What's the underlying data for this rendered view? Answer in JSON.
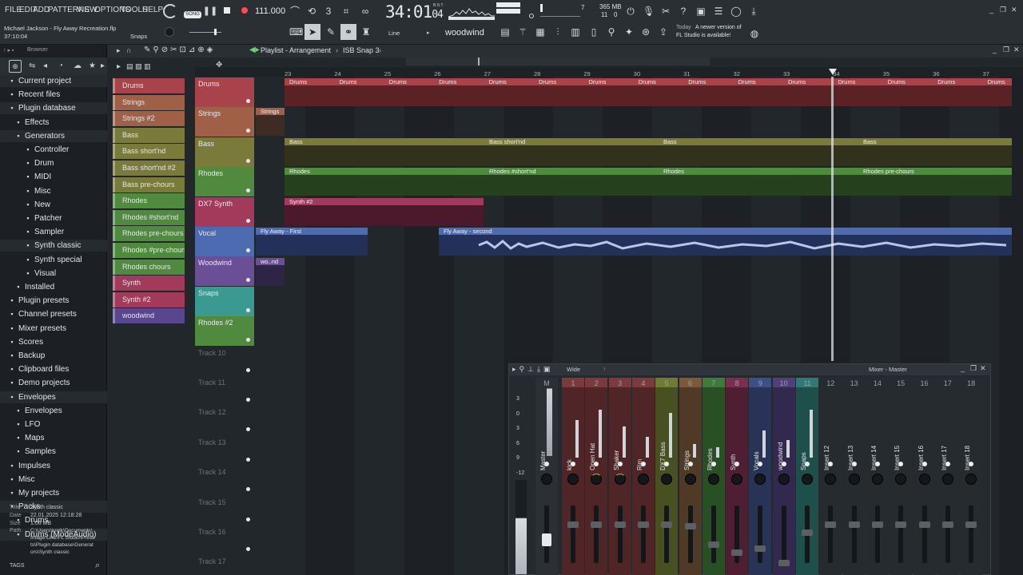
{
  "menu": [
    "FILE",
    "EDIT",
    "ADD",
    "PATTERNS",
    "VIEW",
    "OPTIONS",
    "TOOLS",
    "HELP"
  ],
  "transport": {
    "mode": "SONG",
    "tempo": "111.000",
    "time_main": "34:01",
    "time_sub": "04",
    "time_label": "B:S:T",
    "memory": "365 MB",
    "cpu": "11",
    "cpu_val": "0",
    "pattern_val": "7"
  },
  "project": {
    "title": "Michael Jackson - Fly Away Recreation.flp",
    "time": "37:10:04",
    "snap_label": "Snaps"
  },
  "toolbar": {
    "line_label": "Line",
    "instrument": "woodwind"
  },
  "notice": {
    "date": "Today",
    "message_line1": "A newer version of",
    "message_line2": "FL Studio is available!"
  },
  "browser": {
    "title": "Browser",
    "items": [
      {
        "label": "Current project",
        "icon": "project-icon"
      },
      {
        "label": "Recent files",
        "icon": "recent-icon"
      },
      {
        "label": "Plugin database",
        "icon": "plug-icon"
      },
      {
        "label": "Effects",
        "icon": "effects-icon"
      },
      {
        "label": "Generators",
        "icon": "generators-icon"
      },
      {
        "label": "Controller",
        "icon": "folder-icon"
      },
      {
        "label": "Drum",
        "icon": "folder-icon"
      },
      {
        "label": "MIDI",
        "icon": "folder-icon"
      },
      {
        "label": "Misc",
        "icon": "folder-icon"
      },
      {
        "label": "New",
        "icon": "folder-icon"
      },
      {
        "label": "Patcher",
        "icon": "folder-icon"
      },
      {
        "label": "Sampler",
        "icon": "folder-icon"
      },
      {
        "label": "Synth classic",
        "icon": "folder-icon"
      },
      {
        "label": "Synth special",
        "icon": "folder-icon"
      },
      {
        "label": "Visual",
        "icon": "folder-icon"
      },
      {
        "label": "Installed",
        "icon": "plug-icon"
      },
      {
        "label": "Plugin presets",
        "icon": "plug-icon"
      },
      {
        "label": "Channel presets",
        "icon": "channel-icon"
      },
      {
        "label": "Mixer presets",
        "icon": "mixer-icon"
      },
      {
        "label": "Scores",
        "icon": "note-icon"
      },
      {
        "label": "Backup",
        "icon": "folder-icon"
      },
      {
        "label": "Clipboard files",
        "icon": "folder-icon"
      },
      {
        "label": "Demo projects",
        "icon": "folder-icon"
      },
      {
        "label": "Envelopes",
        "icon": "folder-icon"
      },
      {
        "label": "Envelopes",
        "icon": "folder-icon"
      },
      {
        "label": "LFO",
        "icon": "folder-icon"
      },
      {
        "label": "Maps",
        "icon": "folder-icon"
      },
      {
        "label": "Samples",
        "icon": "folder-icon"
      },
      {
        "label": "Impulses",
        "icon": "folder-icon"
      },
      {
        "label": "Misc",
        "icon": "folder-icon"
      },
      {
        "label": "My projects",
        "icon": "folder-icon"
      },
      {
        "label": "Packs",
        "icon": "folder-icon"
      },
      {
        "label": "Drums",
        "icon": "folder-icon"
      },
      {
        "label": "Drums (ModeAudio)",
        "icon": "folder-icon"
      }
    ],
    "info": {
      "title_key": "Title",
      "title_val": "Synth classic",
      "date_key": "Date",
      "date_val": "22.01.2025 12:18:28",
      "size_key": "Size",
      "size_val": "1.06 MB",
      "path_key": "Path",
      "path_l1": "C:\\Users\\kretk\\Documents\\",
      "path_l2": "Image-Line\\FL Studio\\Prese",
      "path_l3": "ts\\Plugin database\\Generat",
      "path_l4": "ors\\Synth classic"
    },
    "tags": "TAGS"
  },
  "channels": [
    {
      "label": "Drums",
      "color": "#a8434c"
    },
    {
      "label": "Strings",
      "color": "#a06048"
    },
    {
      "label": "Strings #2",
      "color": "#a06048"
    },
    {
      "label": "Bass",
      "color": "#7a7a3a"
    },
    {
      "label": "Bass short'nd",
      "color": "#7a7a3a"
    },
    {
      "label": "Bass short'nd #2",
      "color": "#7a7a3a"
    },
    {
      "label": "Bass pre-chours",
      "color": "#7a7a3a"
    },
    {
      "label": "Rhodes",
      "color": "#4f8a3e"
    },
    {
      "label": "Rhodes #short'nd",
      "color": "#4f8a3e"
    },
    {
      "label": "Rhodes pre-chours",
      "color": "#4f8a3e"
    },
    {
      "label": "Rhodes #pre-chours",
      "color": "#4f8a3e"
    },
    {
      "label": "Rhodes chours",
      "color": "#4f8a3e"
    },
    {
      "label": "Synth",
      "color": "#a23a5c"
    },
    {
      "label": "Synth #2",
      "color": "#a23a5c"
    },
    {
      "label": "woodwind",
      "color": "#58468e"
    }
  ],
  "playlist": {
    "title": "Playlist - Arrangement",
    "pattern": "ISB Snap 3",
    "bars": [
      "23",
      "24",
      "25",
      "26",
      "27",
      "28",
      "29",
      "30",
      "31",
      "32",
      "33",
      "34",
      "35",
      "36",
      "37"
    ],
    "tracks": [
      {
        "label": "Drums",
        "color": "#a8434c"
      },
      {
        "label": "Strings",
        "color": "#a06048"
      },
      {
        "label": "Bass",
        "color": "#7a7a3a"
      },
      {
        "label": "Rhodes",
        "color": "#4f8a3e"
      },
      {
        "label": "DX7 Synth",
        "color": "#a23a5c"
      },
      {
        "label": "Vocal",
        "color": "#4d6bb0"
      },
      {
        "label": "Woodwind",
        "color": "#6a4f96"
      },
      {
        "label": "Snaps",
        "color": "#3a9a92"
      },
      {
        "label": "Rhodes #2",
        "color": "#4f8a3e"
      },
      {
        "label": "Track 10",
        "color": ""
      },
      {
        "label": "Track 11",
        "color": ""
      },
      {
        "label": "Track 12",
        "color": ""
      },
      {
        "label": "Track 13",
        "color": ""
      },
      {
        "label": "Track 14",
        "color": ""
      },
      {
        "label": "Track 15",
        "color": ""
      },
      {
        "label": "Track 16",
        "color": ""
      },
      {
        "label": "Track 17",
        "color": ""
      }
    ],
    "clips": {
      "drums": "Drums",
      "strings": "Strings",
      "bass": "Bass",
      "bass_short": "Bass short'nd",
      "rhodes": "Rhodes",
      "rhodes_short": "Rhodes #short'nd",
      "rhodes_pre": "Rhodes pre-chours",
      "synth2": "Synth #2",
      "vocal1": "Fly Away - First",
      "vocal2": "Fly Away - second",
      "woodwind": "wo..nd"
    }
  },
  "mixer": {
    "title": "Mixer - Master",
    "view": "Wide",
    "master_label": "Master",
    "master_num": "M",
    "scale": [
      "3",
      "0",
      "3",
      "6",
      "9",
      "-12"
    ],
    "channels": [
      {
        "num": "1",
        "label": "kick",
        "color": "#7a3a3e"
      },
      {
        "num": "2",
        "label": "Open Hat",
        "color": "#7a3a3e"
      },
      {
        "num": "3",
        "label": "Shaker",
        "color": "#7a3a3e"
      },
      {
        "num": "4",
        "label": "Rim",
        "color": "#7a3a3e"
      },
      {
        "num": "5",
        "label": "DX7 Bass",
        "color": "#6f7a33"
      },
      {
        "num": "6",
        "label": "Strings",
        "color": "#7a5a3a"
      },
      {
        "num": "7",
        "label": "Rhodes",
        "color": "#3f7a3a"
      },
      {
        "num": "8",
        "label": "Synth",
        "color": "#7a2f4e"
      },
      {
        "num": "9",
        "label": "Vocals",
        "color": "#3e4f86"
      },
      {
        "num": "10",
        "label": "woodwind",
        "color": "#4f3f7a"
      },
      {
        "num": "11",
        "label": "Snaps",
        "color": "#2f7a74"
      },
      {
        "num": "12",
        "label": "Insert 12",
        "color": ""
      },
      {
        "num": "13",
        "label": "Insert 13",
        "color": ""
      },
      {
        "num": "14",
        "label": "Insert 14",
        "color": ""
      },
      {
        "num": "15",
        "label": "Insert 15",
        "color": ""
      },
      {
        "num": "16",
        "label": "Insert 16",
        "color": ""
      },
      {
        "num": "17",
        "label": "Insert 17",
        "color": ""
      },
      {
        "num": "18",
        "label": "Insert 18",
        "color": ""
      }
    ]
  }
}
